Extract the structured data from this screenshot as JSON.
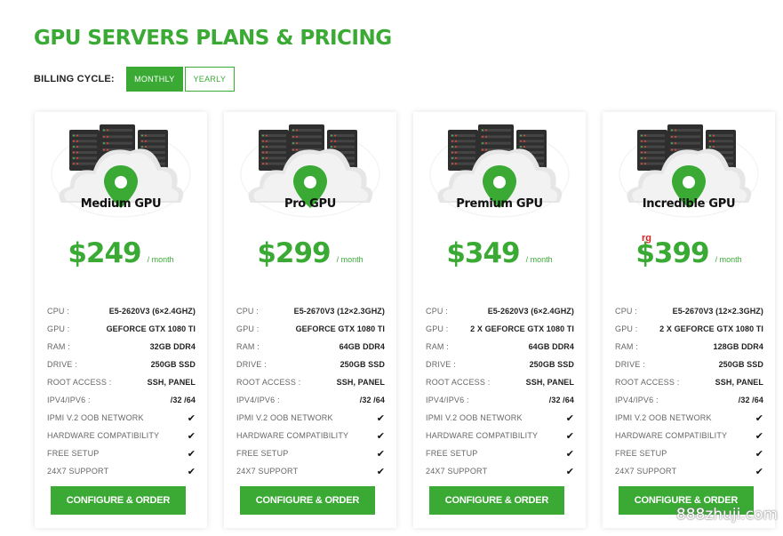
{
  "page_title": "GPU SERVERS PLANS & PRICING",
  "billing": {
    "label": "BILLING CYCLE:",
    "monthly": "MONTHLY",
    "yearly": "YEARLY",
    "selected": "MONTHLY"
  },
  "colors": {
    "brand_green": "#3aaa35"
  },
  "spec_labels": [
    "CPU :",
    "GPU :",
    "RAM :",
    "DRIVE :",
    "ROOT ACCESS :",
    "IPV4/IPV6 :",
    "IPMI V.2 OOB NETWORK",
    "HARDWARE COMPATIBILITY",
    "FREE SETUP",
    "24X7 SUPPORT"
  ],
  "plans": [
    {
      "name": "Medium GPU",
      "price": "$249",
      "period": "/ month",
      "specs": [
        "E5-2620V3 (6×2.4GHZ)",
        "GEFORCE GTX 1080 TI",
        "32GB DDR4",
        "250GB SSD",
        "SSH, PANEL",
        "/32 /64",
        "✔",
        "✔",
        "✔",
        "✔"
      ],
      "button": "CONFIGURE & ORDER"
    },
    {
      "name": "Pro GPU",
      "price": "$299",
      "period": "/ month",
      "specs": [
        "E5-2670V3 (12×2.3GHZ)",
        "GEFORCE GTX 1080 TI",
        "64GB DDR4",
        "250GB SSD",
        "SSH, PANEL",
        "/32 /64",
        "✔",
        "✔",
        "✔",
        "✔"
      ],
      "button": "CONFIGURE & ORDER"
    },
    {
      "name": "Premium GPU",
      "price": "$349",
      "period": "/ month",
      "specs": [
        "E5-2620V3 (6×2.4GHZ)",
        "2 X GEFORCE GTX 1080 TI",
        "64GB DDR4",
        "250GB SSD",
        "SSH, PANEL",
        "/32 /64",
        "✔",
        "✔",
        "✔",
        "✔"
      ],
      "button": "CONFIGURE & ORDER"
    },
    {
      "name": "Incredible GPU",
      "price": "$399",
      "period": "/ month",
      "specs": [
        "E5-2670V3 (12×2.3GHZ)",
        "2 X GEFORCE GTX 1080 TI",
        "128GB DDR4",
        "250GB SSD",
        "SSH, PANEL",
        "/32 /64",
        "✔",
        "✔",
        "✔",
        "✔"
      ],
      "button": "CONFIGURE & ORDER"
    }
  ],
  "overlay_mark": "rg",
  "watermark": "888zhuji.com"
}
